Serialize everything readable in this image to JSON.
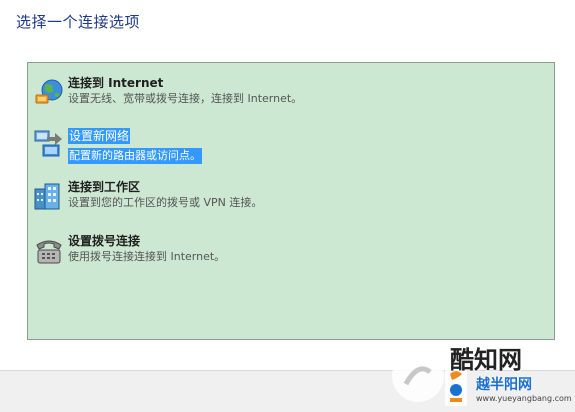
{
  "page_title": "选择一个连接选项",
  "options": [
    {
      "title": "连接到 Internet",
      "desc": "设置无线、宽带或拨号连接，连接到 Internet。",
      "icon": "globe-network-icon",
      "selected": false
    },
    {
      "title": "设置新网络",
      "desc": "配置新的路由器或访问点。",
      "icon": "network-computers-icon",
      "selected": true
    },
    {
      "title": "连接到工作区",
      "desc": "设置到您的工作区的拨号或 VPN 连接。",
      "icon": "workplace-building-icon",
      "selected": false
    },
    {
      "title": "设置拨号连接",
      "desc": "使用拨号连接连接到 Internet。",
      "icon": "telephone-modem-icon",
      "selected": false
    }
  ],
  "watermark": {
    "line1": "酷知网",
    "line2": "越半阳网",
    "url": "www.yueyangbang.com"
  },
  "colors": {
    "panel_bg": "#cde8d2",
    "selection": "#3399ff",
    "title_text": "#1e3a8a"
  }
}
